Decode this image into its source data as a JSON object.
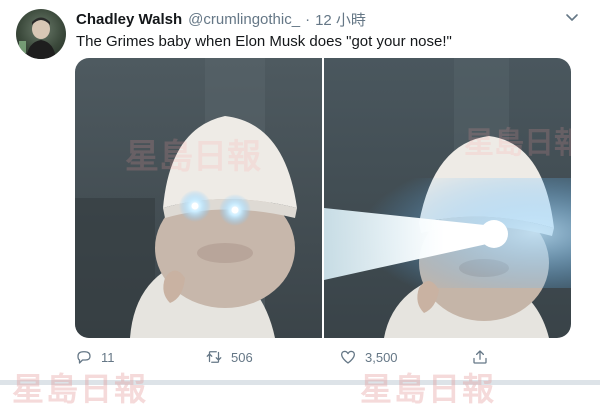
{
  "user": {
    "display_name": "Chadley Walsh",
    "handle": "@crumlingothic_",
    "separator": "·",
    "time": "12 小時"
  },
  "tweet": {
    "text": "The Grimes baby when Elon Musk does \"got your nose!\""
  },
  "actions": {
    "reply_count": "11",
    "retweet_count": "506",
    "like_count": "3,500"
  },
  "watermark": {
    "text": "星島日報"
  },
  "icons": {
    "menu": "chevron-down-icon",
    "reply": "reply-icon",
    "retweet": "retweet-icon",
    "like": "heart-icon",
    "share": "share-icon"
  },
  "colors": {
    "text_primary": "#14171a",
    "text_secondary": "#657786",
    "glow": "#bfe6ff"
  }
}
